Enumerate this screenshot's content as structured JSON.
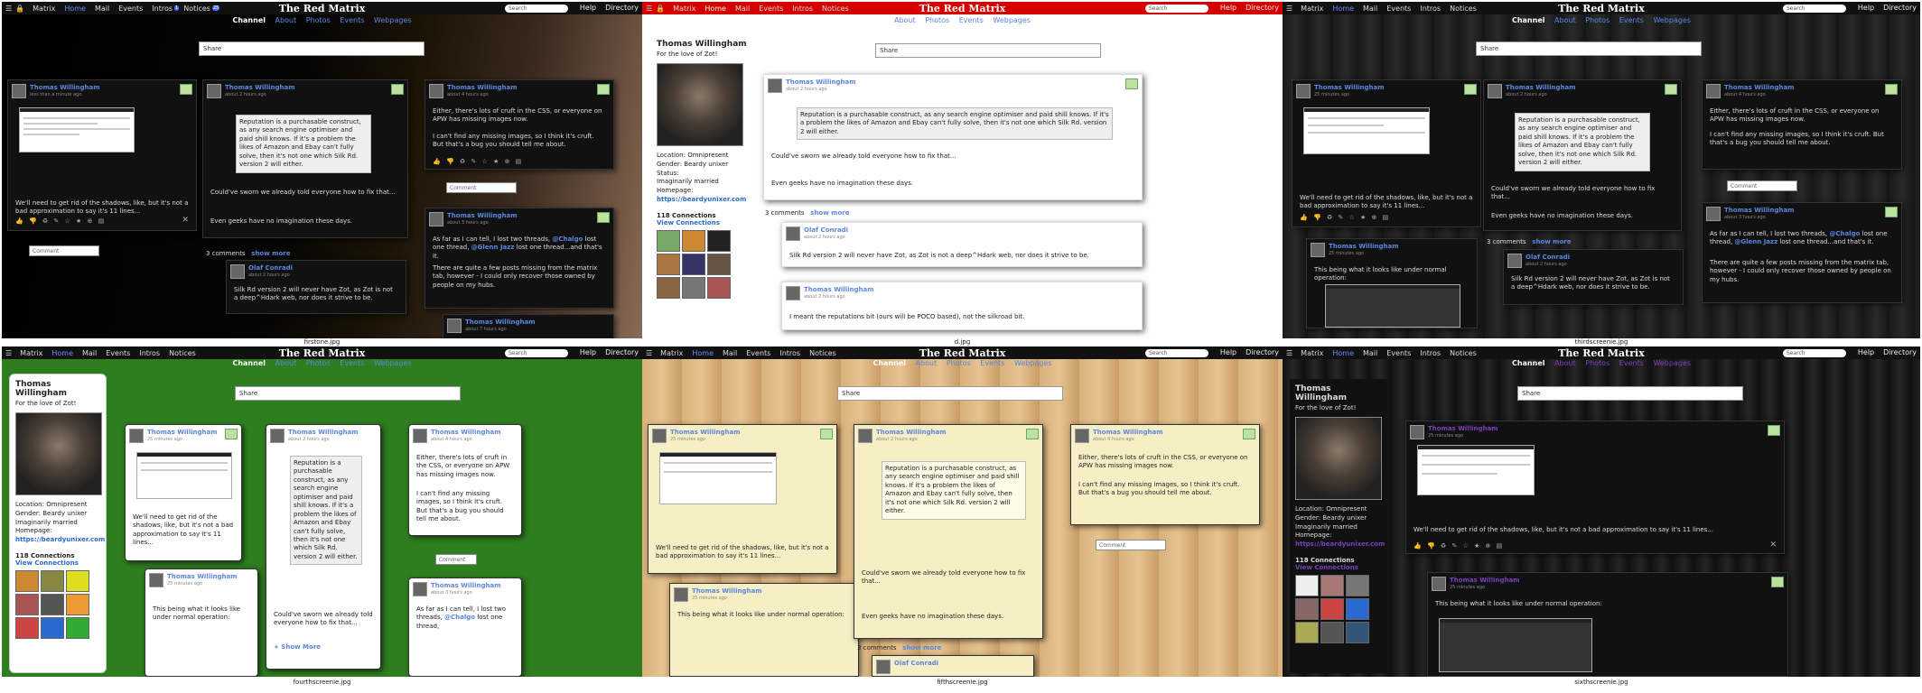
{
  "menu": {
    "matrix": "Matrix",
    "home": "Home",
    "mail": "Mail",
    "events": "Events",
    "intros": "Intros",
    "notices": "Notices",
    "brand": "The Red Matrix",
    "search": "Search",
    "help": "Help",
    "directory": "Directory",
    "badge_intros": "1",
    "badge_notices": "25"
  },
  "tabs": {
    "channel": "Channel",
    "about": "About",
    "photos": "Photos",
    "events": "Events",
    "webpages": "Webpages"
  },
  "share": "Share",
  "comment_placeholder": "Comment",
  "author": "Thomas Willingham",
  "author2": "Olaf Conradi",
  "times": {
    "t1": "less than a minute ago",
    "t2": "about 2 hours ago",
    "t3": "25 minutes ago",
    "t4": "about 4 hours ago",
    "t5": "about 3 hours ago",
    "t6": "about 6 hours ago",
    "t7": "about 7 hours ago"
  },
  "posts": {
    "shadows": "We'll need to get rid of the shadows, like, but it's not a bad approximation to say it's 11 lines...",
    "reputation": "Reputation is a purchasable construct, as any search engine optimiser and paid shill knows. If it's a problem the likes of Amazon and Ebay can't fully solve, then it's not one which Silk Rd. version 2 will either.",
    "couldve": "Could've sworn we already told everyone how to fix that...",
    "geeks": "Even geeks have no imagination these days.",
    "cruft": "Either, there's lots of cruft in the CSS, or everyone on APW has missing images now.",
    "cantfind": "I can't find any missing images, so I think it's cruft.  But that's a bug you should tell me about.",
    "threads_a": "As far as I can tell, I lost two threads, ",
    "chalgo": "@Chalgo",
    "threads_b": " lost one thread, ",
    "glenn": "@Glenn Jazz",
    "threads_c": " lost one thread...and that's it.",
    "missing": "There are quite a few posts missing from the matrix tab, however - I could only recover those owned by people on my hubs.",
    "silkrd": "Silk Rd version 2 will never have Zot, as Zot is not a deep^Hdark web, nor does it strive to be.",
    "normal": "This being what it looks like under normal operation:",
    "reputations": "I meant the reputations bit (ours will be POCO based), not the silkroad bit."
  },
  "comments_count": "3 comments",
  "show_more": "show more",
  "show_more2": "+ Show More",
  "profile": {
    "name": "Thomas Willingham",
    "tagline": "For the love of Zot!",
    "location": "Location:  Omnipresent",
    "gender": "Gender:  Beardy unixer",
    "status": "Status:",
    "status_val": "Imaginarily married",
    "homepage": "Homepage:",
    "homepage_url": "https://beardyunixer.com",
    "connections": "118 Connections",
    "view_connections": "View Connections"
  },
  "files": {
    "f1": "firstone.jpg",
    "f2": "d.jpg",
    "f3": "thirdscreenie.jpg",
    "f4": "fourthscreenie.jpg",
    "f5": "fifthscreenie.jpg",
    "f6": "sixthscreenie.jpg"
  },
  "actions": "👍 👎 ♻ ✎ ☆ ★ ⊕ ▤",
  "colors": {
    "accent": "#5b87e0",
    "red_bar": "#d40000",
    "green_bg": "#2e7d1f",
    "wood": "#d9b27c",
    "dark": "#111111"
  }
}
